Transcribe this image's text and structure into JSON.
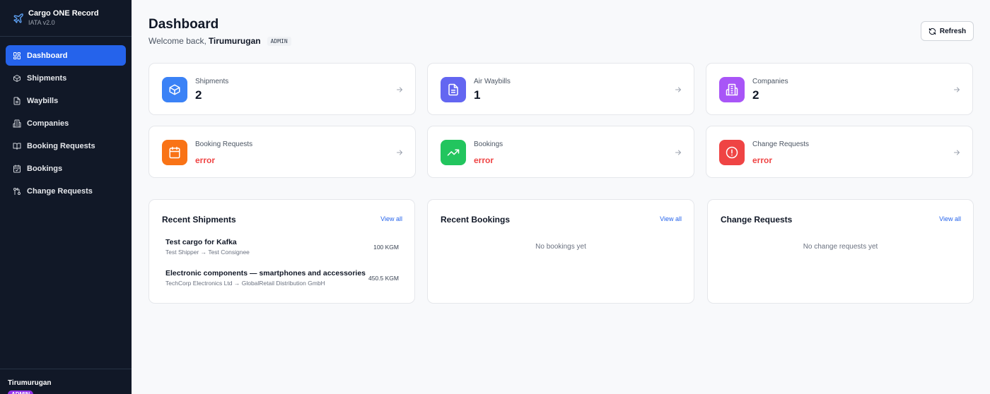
{
  "brand": {
    "title": "Cargo ONE Record",
    "subtitle": "IATA v2.0"
  },
  "sidebar": {
    "items": [
      {
        "label": "Dashboard",
        "icon": "grid-icon",
        "active": true
      },
      {
        "label": "Shipments",
        "icon": "box-icon"
      },
      {
        "label": "Waybills",
        "icon": "document-icon"
      },
      {
        "label": "Companies",
        "icon": "building-icon"
      },
      {
        "label": "Booking Requests",
        "icon": "book-icon"
      },
      {
        "label": "Bookings",
        "icon": "calendar-check-icon"
      },
      {
        "label": "Change Requests",
        "icon": "git-compare-icon"
      }
    ],
    "user": {
      "name": "Tirumurugan",
      "role": "ADMIN"
    }
  },
  "header": {
    "title": "Dashboard",
    "welcome_prefix": "Welcome back,",
    "username": "Tirumurugan",
    "role": "ADMIN",
    "refresh_label": "Refresh"
  },
  "stats": [
    {
      "label": "Shipments",
      "value": "2",
      "color": "#3b82f6",
      "icon": "box-icon"
    },
    {
      "label": "Air Waybills",
      "value": "1",
      "color": "#6366f1",
      "icon": "document-icon"
    },
    {
      "label": "Companies",
      "value": "2",
      "color": "#a855f7",
      "icon": "building-icon"
    },
    {
      "label": "Booking Requests",
      "value": "error",
      "color": "#f97316",
      "icon": "calendar-icon"
    },
    {
      "label": "Bookings",
      "value": "error",
      "color": "#22c55e",
      "icon": "trending-up-icon"
    },
    {
      "label": "Change Requests",
      "value": "error",
      "color": "#ef4444",
      "icon": "alert-circle-icon"
    }
  ],
  "panels": {
    "recent_shipments": {
      "title": "Recent Shipments",
      "view_all": "View all",
      "items": [
        {
          "name": "Test cargo for Kafka",
          "route": "Test Shipper → Test Consignee",
          "weight": "100 KGM"
        },
        {
          "name": "Electronic components — smartphones and accessories",
          "route": "TechCorp Electronics Ltd → GlobalRetail Distribution GmbH",
          "weight": "450.5 KGM"
        }
      ]
    },
    "recent_bookings": {
      "title": "Recent Bookings",
      "view_all": "View all",
      "empty": "No bookings yet"
    },
    "change_requests": {
      "title": "Change Requests",
      "view_all": "View all",
      "empty": "No change requests yet"
    }
  },
  "colors": {
    "sidebar_bg": "#111827",
    "accent": "#2563eb",
    "error": "#ef4444"
  }
}
